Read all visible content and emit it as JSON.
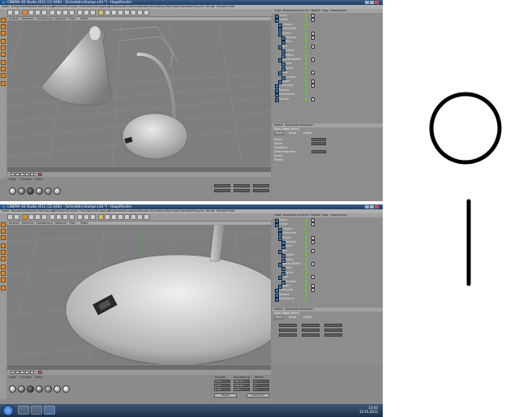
{
  "window": {
    "title": "CINEMA 4D Studio (R12 (12.048)) - [Schreibtischlampe.c4d *] - Hauptfenster",
    "controls": [
      "minimize",
      "maximize",
      "close"
    ]
  },
  "menubar": [
    "Datei",
    "Bearbeiten",
    "Objekte",
    "Werkzeuge",
    "Selektion",
    "Struktur",
    "Funktionen",
    "Snapping",
    "Animation",
    "Simulation",
    "Rendern",
    "Sculpting",
    "MoGraph",
    "Charakter",
    "Plug-ins",
    "Skript",
    "Fenster",
    "Hilfe"
  ],
  "viewport_menu": [
    "Ansicht",
    "Kameras",
    "Darstellung",
    "Optionen",
    "Filter",
    "Tafeln"
  ],
  "viewport_label": "Perspektive",
  "material_menu": [
    "Datei",
    "Funktion",
    "Textur"
  ],
  "object_manager": {
    "menu": [
      "Datei",
      "Bearbeiten",
      "Ansicht",
      "Objekte",
      "Tags",
      "Lesezeichen"
    ],
    "items": [
      {
        "label": "Boden",
        "indent": 0
      },
      {
        "label": "Lampe",
        "indent": 0
      },
      {
        "label": "Lampe.1",
        "indent": 1
      },
      {
        "label": "Lichtquelle",
        "indent": 1
      },
      {
        "label": "Schirm",
        "indent": 1
      },
      {
        "label": "Fassung",
        "indent": 2
      },
      {
        "label": "Birne",
        "indent": 2
      },
      {
        "label": "Arm",
        "indent": 1
      },
      {
        "label": "Gelenk",
        "indent": 2
      },
      {
        "label": "Halter",
        "indent": 2
      },
      {
        "label": "Sweep-NURBS",
        "indent": 1
      },
      {
        "label": "Kreis",
        "indent": 2
      },
      {
        "label": "Spline",
        "indent": 2
      },
      {
        "label": "Fuss",
        "indent": 1
      },
      {
        "label": "Schalter",
        "indent": 2
      },
      {
        "label": "Kabel",
        "indent": 1
      },
      {
        "label": "Lichtquelle",
        "indent": 0
      },
      {
        "label": "Kamera",
        "indent": 0
      },
      {
        "label": "Hintergrund",
        "indent": 0
      },
      {
        "label": "Himmel",
        "indent": 0
      }
    ]
  },
  "attribute_manager": {
    "menu": [
      "Modus",
      "Bearbeiten",
      "Benutzer"
    ],
    "title": "Kreis-Objekt [Kreis]",
    "tabs": [
      "Basis",
      "Koord.",
      "Objekt"
    ],
    "rows": [
      "Radius",
      "Ebene",
      "Umkehren",
      "Zwischenpunkte",
      "Anzahl",
      "Winkel"
    ]
  },
  "coordinates": {
    "headers": [
      "Position",
      "Abmessung",
      "Winkel"
    ],
    "axes": [
      "X",
      "Y",
      "Z"
    ],
    "values": [
      [
        "0 cm",
        "100 cm",
        "0 °"
      ],
      [
        "0 cm",
        "100 cm",
        "0 °"
      ],
      [
        "0 cm",
        "0 cm",
        "0 °"
      ]
    ],
    "apply_label": "Anwenden",
    "mode_label": "Objekt"
  },
  "taskbar": {
    "time": "13:45",
    "date": "12.01.2012"
  },
  "colors": {
    "viewport": "#7e7e7e",
    "panel": "#8d8d8d",
    "accent_orange": "#e08a2a",
    "taskbar": "#1c2f48"
  },
  "icons": {
    "sketch_top": "circle-outline",
    "sketch_bottom": "vertical-bar"
  }
}
